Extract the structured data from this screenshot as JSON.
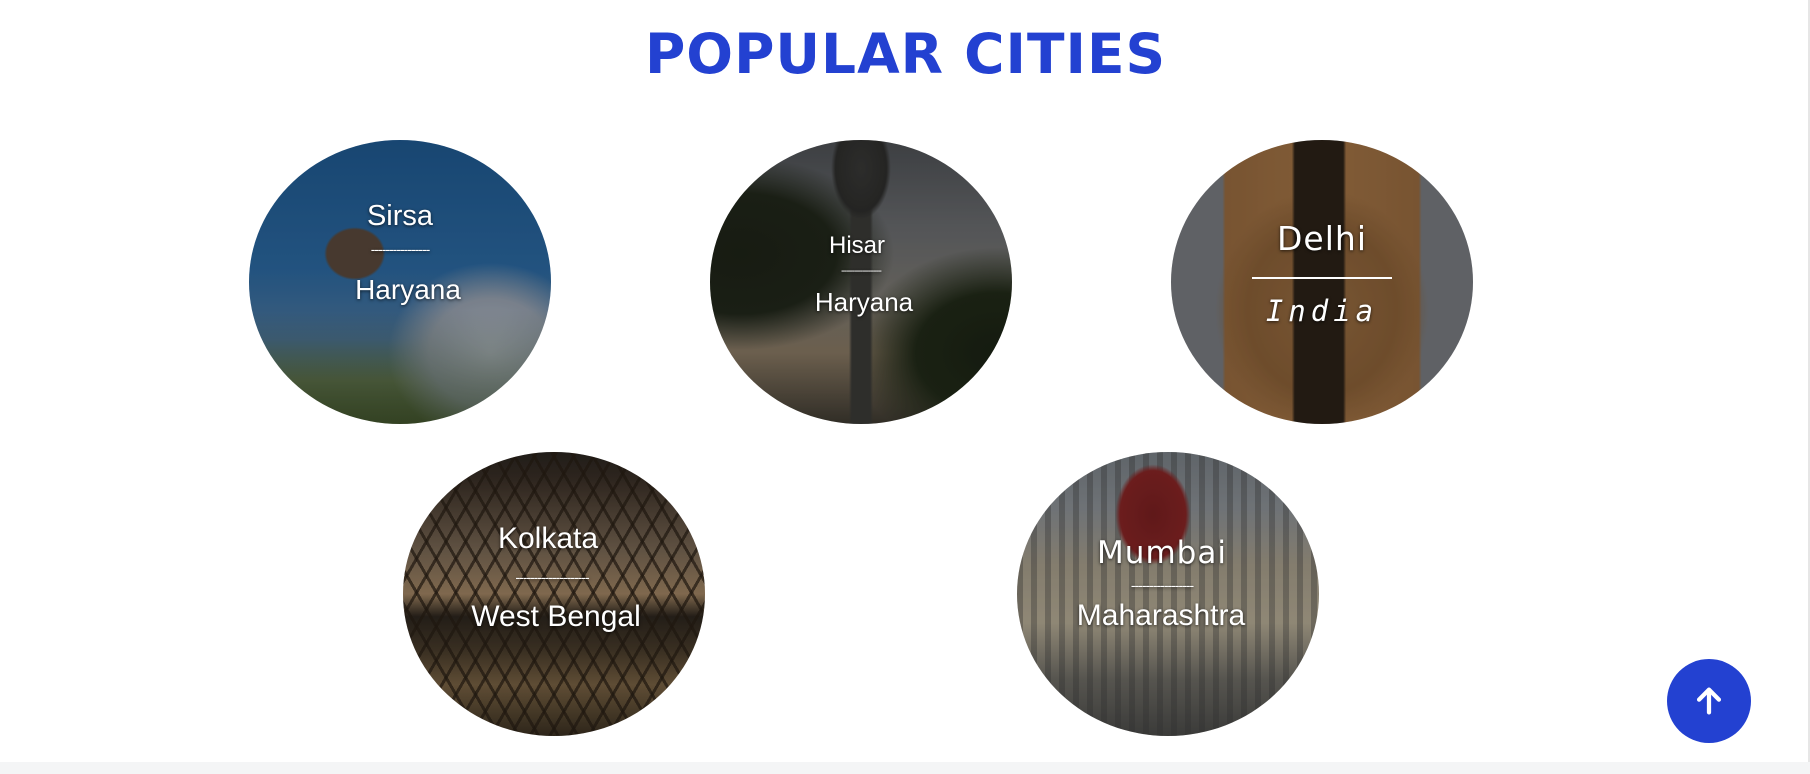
{
  "section": {
    "title": "POPULAR CITIES"
  },
  "cities": [
    {
      "name": "Sirsa",
      "divider": "----------------",
      "region": "Haryana"
    },
    {
      "name": "Hisar",
      "divider": "---------------",
      "region": "Haryana"
    },
    {
      "name": "Delhi",
      "region": "India"
    },
    {
      "name": "Kolkata",
      "divider": "--------------------",
      "region": "West Bengal"
    },
    {
      "name": "Mumbai",
      "divider": "-----------------",
      "region": "Maharashtra"
    }
  ],
  "scroll_top": {
    "icon": "arrow-up-icon",
    "color": "#2341d1"
  },
  "colors": {
    "accent": "#2341d1",
    "background": "#ffffff"
  }
}
